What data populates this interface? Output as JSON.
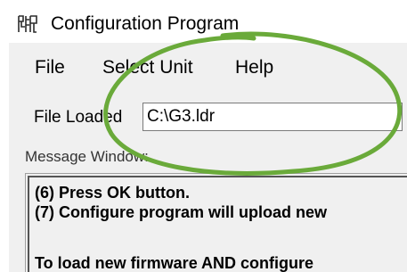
{
  "window": {
    "title": "Configuration Program",
    "app_icon": "app-logo-icon"
  },
  "menu": {
    "items": [
      {
        "label": "File"
      },
      {
        "label": "Select Unit"
      },
      {
        "label": "Help"
      }
    ]
  },
  "file_loaded": {
    "label": "File Loaded",
    "value": "C:\\G3.ldr"
  },
  "message_window": {
    "label": "Message Window:",
    "lines": [
      "(6) Press OK button.",
      "(7) Configure program will upload new",
      "",
      "To load new firmware AND configure"
    ]
  },
  "annotation": {
    "shape": "ellipse",
    "color": "#6aaa3a"
  }
}
